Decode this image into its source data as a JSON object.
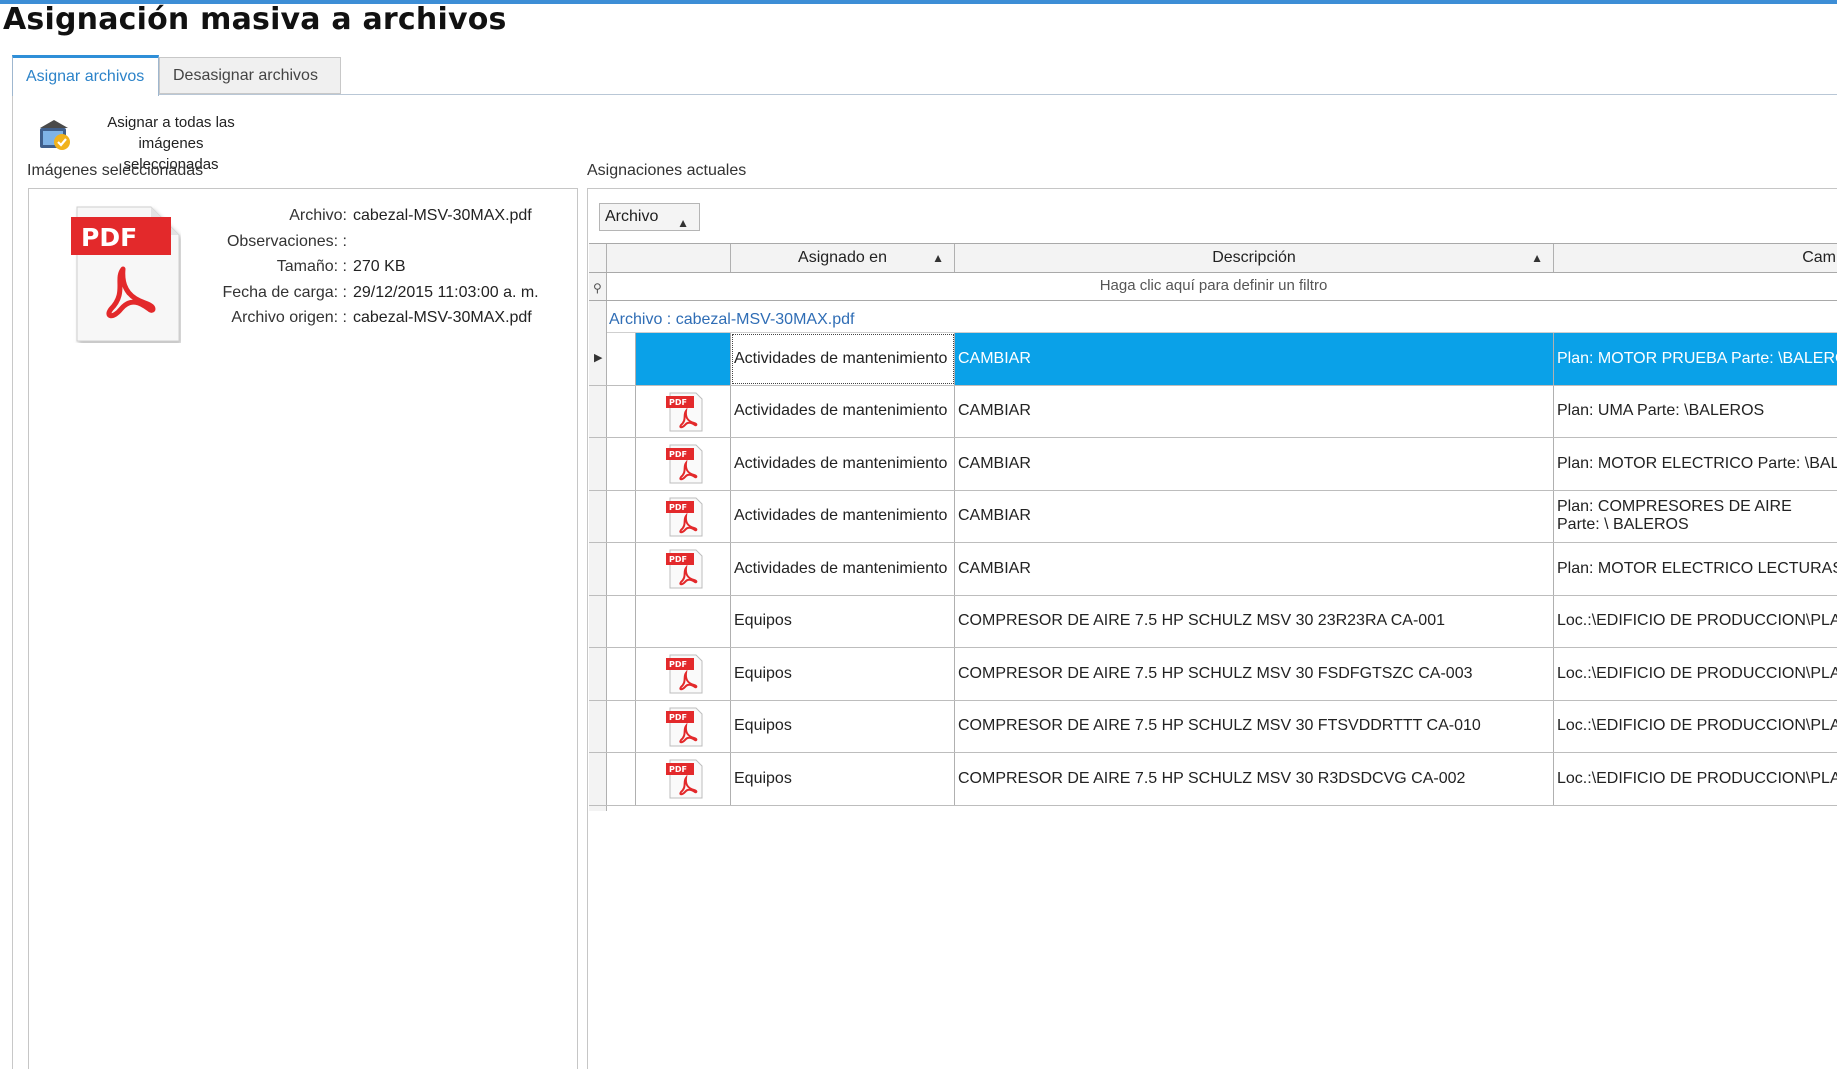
{
  "page": {
    "title": "Asignación masiva a archivos"
  },
  "tabs": [
    {
      "label": "Asignar archivos",
      "active": true
    },
    {
      "label": "Desasignar archivos",
      "active": false
    }
  ],
  "toolbar": {
    "assign_all_label_line1": "Asignar a todas las",
    "assign_all_label_line2": "imágenes seleccionadas",
    "icon": "assign-images-icon"
  },
  "left": {
    "section_label": "Imágenes seleccionadas",
    "file_icon_text": "PDF",
    "info": [
      {
        "key": "Archivo:",
        "value": "cabezal-MSV-30MAX.pdf"
      },
      {
        "key": "Observaciones: :",
        "value": ""
      },
      {
        "key": "Tamaño: :",
        "value": "270 KB"
      },
      {
        "key": "Fecha de carga: :",
        "value": "29/12/2015 11:03:00 a. m."
      },
      {
        "key": "Archivo origen: :",
        "value": "cabezal-MSV-30MAX.pdf"
      }
    ]
  },
  "right": {
    "section_label": "Asignaciones actuales",
    "group_chip": "Archivo",
    "columns": {
      "assigned": "Asignado en",
      "description": "Descripción",
      "extra": "Cam"
    },
    "filter_text": "Haga clic aquí para definir un filtro",
    "group_row": "Archivo : cabezal-MSV-30MAX.pdf",
    "rows": [
      {
        "has_pdf": false,
        "assigned": "Actividades de mantenimiento",
        "description": "CAMBIAR",
        "extra": "Plan: MOTOR PRUEBA  Parte: \\BALEROS",
        "selected": true
      },
      {
        "has_pdf": true,
        "assigned": "Actividades de mantenimiento",
        "description": "CAMBIAR",
        "extra": "Plan: UMA  Parte: \\BALEROS"
      },
      {
        "has_pdf": true,
        "assigned": "Actividades de mantenimiento",
        "description": "CAMBIAR",
        "extra": "Plan: MOTOR ELECTRICO  Parte: \\BALEROS"
      },
      {
        "has_pdf": true,
        "assigned": "Actividades de mantenimiento",
        "description": "CAMBIAR",
        "extra": "Plan: COMPRESORES DE AIRE  Parte: \\ BALEROS",
        "wrap": true
      },
      {
        "has_pdf": true,
        "assigned": "Actividades de mantenimiento",
        "description": "CAMBIAR",
        "extra": "Plan: MOTOR ELECTRICO LECTURAS"
      },
      {
        "has_pdf": false,
        "assigned": "Equipos",
        "description": "COMPRESOR DE AIRE 7.5 HP SCHULZ MSV 30 23R23RA CA-001",
        "extra": "Loc.:\\EDIFICIO DE PRODUCCION\\PLANTA"
      },
      {
        "has_pdf": true,
        "assigned": "Equipos",
        "description": "COMPRESOR DE AIRE 7.5 HP SCHULZ MSV 30 FSDFGTSZC CA-003",
        "extra": "Loc.:\\EDIFICIO DE PRODUCCION\\PLANTA"
      },
      {
        "has_pdf": true,
        "assigned": "Equipos",
        "description": "COMPRESOR DE AIRE 7.5 HP SCHULZ MSV 30 FTSVDDRTTT CA-010",
        "extra": "Loc.:\\EDIFICIO DE PRODUCCION\\PLANTA"
      },
      {
        "has_pdf": true,
        "assigned": "Equipos",
        "description": "COMPRESOR DE AIRE 7.5 HP SCHULZ MSV 30 R3DSDCVG CA-002",
        "extra": "Loc.:\\EDIFICIO DE PRODUCCION\\PLANTA"
      }
    ]
  },
  "colors": {
    "accent": "#2f8fd8",
    "selection": "#0aa1e8",
    "pdf_red": "#e3292b",
    "link": "#2f6db5"
  }
}
